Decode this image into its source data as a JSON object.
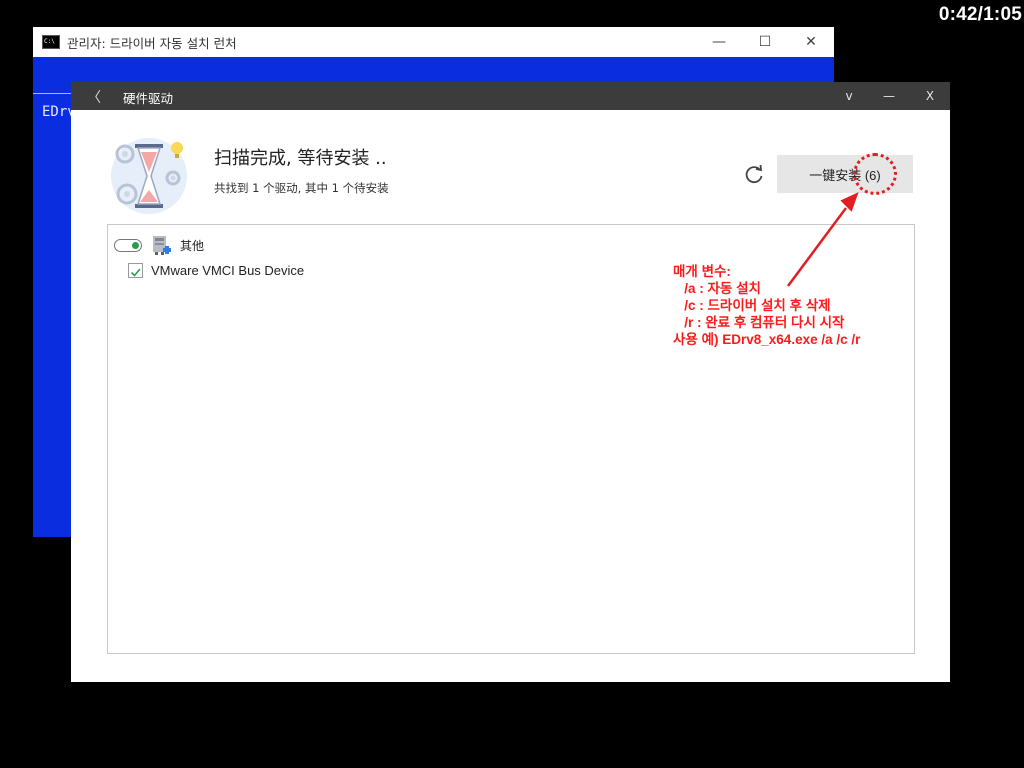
{
  "timer": "0:42/1:05",
  "console": {
    "title": "관리자:  드라이버 자동 설치 런처",
    "minimize": "—",
    "maximize": "☐",
    "close": "✕",
    "text": "EDrv"
  },
  "app": {
    "back": "〈",
    "title": "硬件驱动",
    "menu": "v",
    "minimize": "—",
    "close": "X",
    "status_title": "扫描完成, 等待安装 ..",
    "status_sub": "共找到 1 个驱动, 其中 1 个待安装",
    "install_label": "一键安装 (6)",
    "group": {
      "label": "其他",
      "enabled": true
    },
    "items": [
      {
        "label": "VMware VMCI Bus Device",
        "checked": true
      }
    ]
  },
  "annotation": {
    "color": "#e02020",
    "lines": [
      "매개 변수:",
      "   /a : 자동 설치",
      "   /c : 드라이버 설치 후 삭제",
      "   /r : 완료 후 컴퓨터 다시 시작",
      "사용 예) EDrv8_x64.exe /a /c /r"
    ]
  }
}
